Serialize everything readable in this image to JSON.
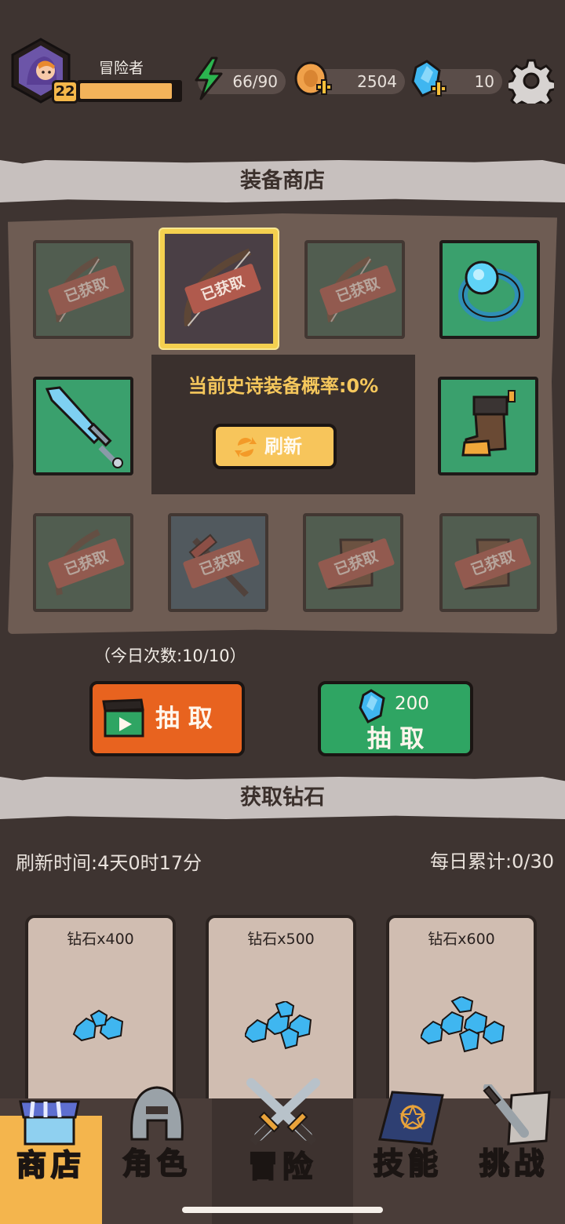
{
  "player": {
    "name": "冒险者",
    "level": "22",
    "xp_fraction": 0.93
  },
  "resources": {
    "energy": "66/90",
    "coins": "2504",
    "gems": "10"
  },
  "shop": {
    "title": "装备商店",
    "owned_tag": "已获取",
    "epic_rate": "当前史诗装备概率:0%",
    "refresh_label": "刷新",
    "daily_count": "（今日次数:10/10）",
    "draw_ad_label": "抽 取",
    "draw_gem_cost": "200",
    "draw_gem_label": "抽 取",
    "slots": [
      {
        "item": "bow",
        "owned": true
      },
      {
        "item": "bow",
        "owned": true,
        "selected": true
      },
      {
        "item": "bow",
        "owned": true
      },
      {
        "item": "ring",
        "owned": false
      },
      {
        "item": "sword",
        "owned": false
      },
      {
        "item": "boot",
        "owned": false
      },
      {
        "item": "bow",
        "owned": true
      },
      {
        "item": "dagger",
        "owned": true
      },
      {
        "item": "boot",
        "owned": true
      },
      {
        "item": "boot",
        "owned": true
      }
    ]
  },
  "gems_section": {
    "title": "获取钻石",
    "refresh_time": "刷新时间:4天0时17分",
    "daily_total": "每日累计:0/30",
    "cards": [
      {
        "label": "钻石x400"
      },
      {
        "label": "钻石x500"
      },
      {
        "label": "钻石x600"
      }
    ]
  },
  "nav": {
    "shop": "商店",
    "character": "角色",
    "adventure": "冒险",
    "skills": "技能",
    "challenge": "挑战"
  },
  "colors": {
    "background": "#3e3431",
    "accent_gold": "#f5c75c",
    "draw_ad": "#e8631f",
    "draw_gem": "#2fa563",
    "gem_blue": "#3fb6f0"
  }
}
